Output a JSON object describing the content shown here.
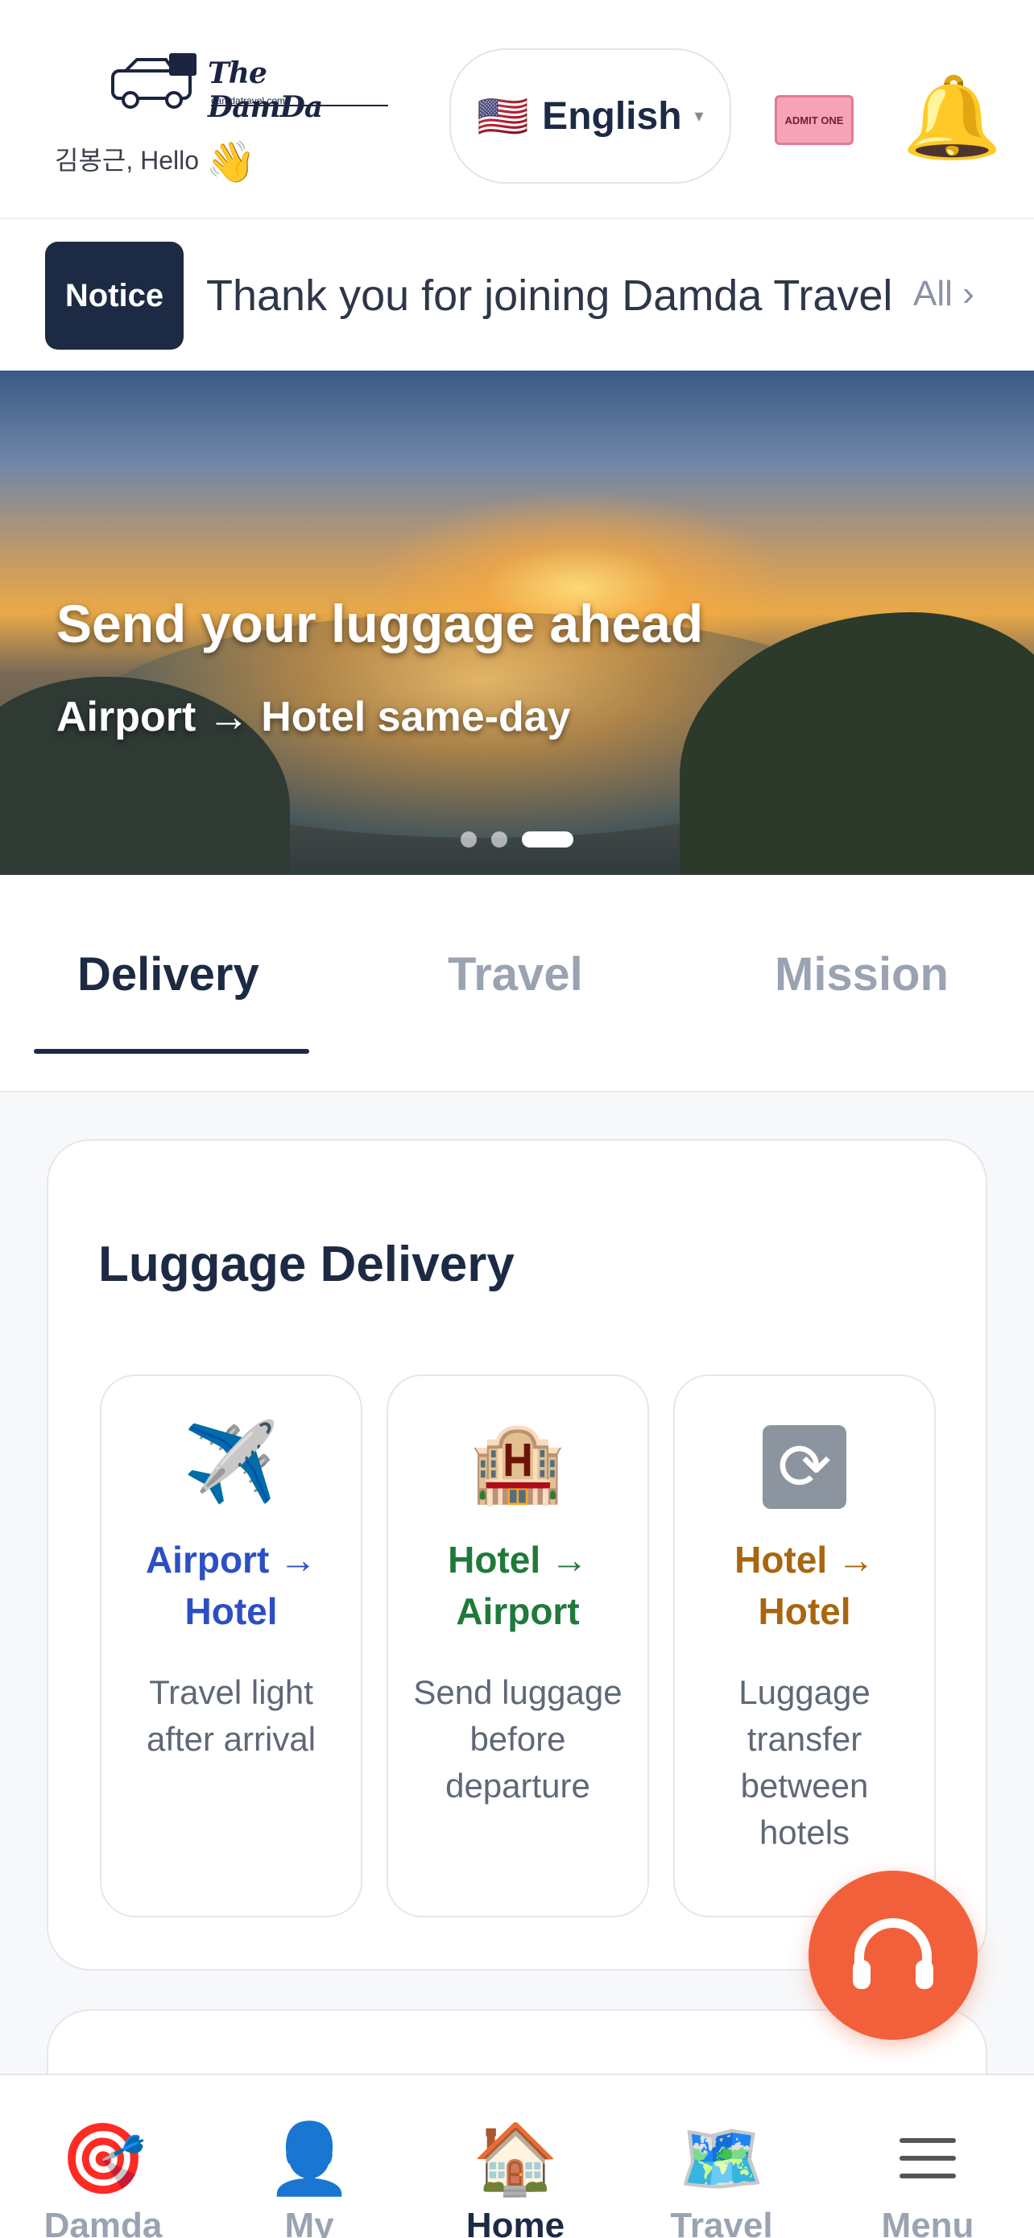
{
  "header": {
    "logo_text": "The DamDa",
    "logo_sub": "damdatravel.com",
    "greeting": "김봉근, Hello",
    "greeting_icon": "waving-hand-icon",
    "language": "English",
    "language_flag": "🇺🇸",
    "ticket_label": "ADMIT ONE",
    "bell_icon": "bell-icon"
  },
  "notice": {
    "badge": "Notice",
    "text": "Thank you for joining Damda Travel",
    "all_label": "All ›"
  },
  "banner": {
    "title": "Send your luggage ahead",
    "subtitle": "Airport → Hotel same-day",
    "slide_count": 3,
    "active_slide": 3
  },
  "tabs": [
    {
      "label": "Delivery",
      "active": true
    },
    {
      "label": "Travel",
      "active": false
    },
    {
      "label": "Mission",
      "active": false
    }
  ],
  "delivery_card": {
    "title": "Luggage Delivery",
    "services": [
      {
        "icon": "airplane-icon",
        "glyph": "✈️",
        "name": "Airport → Hotel",
        "desc": "Travel light after arrival",
        "color": "#2b4fc4"
      },
      {
        "icon": "hotel-icon",
        "glyph": "🏨",
        "name": "Hotel → Airport",
        "desc": "Send luggage before departure",
        "color": "#1f7a3a"
      },
      {
        "icon": "refresh-icon",
        "glyph": "🔄",
        "name": "Hotel → Hotel",
        "desc": "Luggage transfer between hotels",
        "color": "#a8660e"
      }
    ]
  },
  "bottom_nav": [
    {
      "icon": "target-icon",
      "glyph": "🎯",
      "label": "Damda"
    },
    {
      "icon": "user-icon",
      "glyph": "👤",
      "label": "My"
    },
    {
      "icon": "home-icon",
      "glyph": "🏠",
      "label": "Home",
      "active": true
    },
    {
      "icon": "map-icon",
      "glyph": "🗺️",
      "label": "Travel"
    },
    {
      "icon": "menu-icon",
      "glyph": "",
      "label": "Menu"
    }
  ],
  "colors": {
    "primary": "#1c2a44",
    "fab": "#f2603b",
    "muted": "#9aa3b2"
  }
}
